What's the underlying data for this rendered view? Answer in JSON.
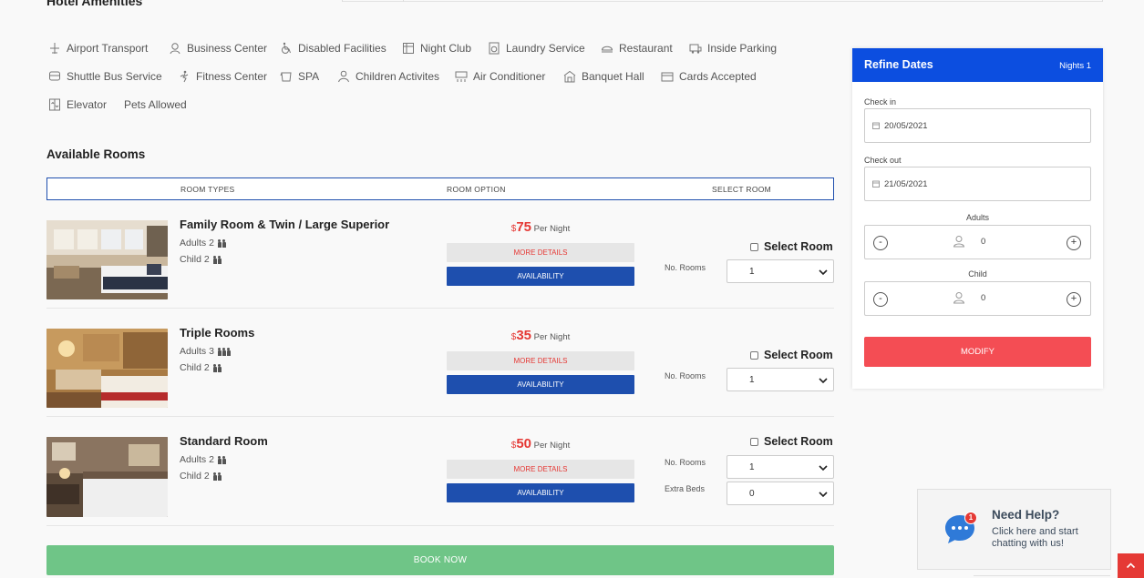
{
  "amenities_title": "Hotel Amenities",
  "amenities": [
    {
      "label": "Airport Transport",
      "icon": "airplane-icon"
    },
    {
      "label": "Business Center",
      "icon": "business-center-icon"
    },
    {
      "label": "Disabled Facilities",
      "icon": "wheelchair-icon"
    },
    {
      "label": "Night Club",
      "icon": "night-club-icon"
    },
    {
      "label": "Laundry Service",
      "icon": "laundry-icon"
    },
    {
      "label": "Restaurant",
      "icon": "restaurant-icon"
    },
    {
      "label": "Inside Parking",
      "icon": "parking-icon"
    },
    {
      "label": "Shuttle Bus Service",
      "icon": "bus-icon"
    },
    {
      "label": "Fitness Center",
      "icon": "fitness-icon"
    },
    {
      "label": "SPA",
      "icon": "spa-icon"
    },
    {
      "label": "Children Activites",
      "icon": "children-icon"
    },
    {
      "label": "Air Conditioner",
      "icon": "air-conditioner-icon"
    },
    {
      "label": "Banquet Hall",
      "icon": "banquet-hall-icon"
    },
    {
      "label": "Cards Accepted",
      "icon": "credit-card-icon"
    },
    {
      "label": "Elevator",
      "icon": "elevator-icon"
    },
    {
      "label": "Pets Allowed",
      "icon": ""
    }
  ],
  "rooms_section": {
    "title": "Available Rooms",
    "headers": [
      "ROOM TYPES",
      "ROOM OPTION",
      "SELECT ROOM"
    ]
  },
  "rooms": [
    {
      "name": "Family Room & Twin / Large Superior",
      "adults_label": "Adults 2",
      "adults": 2,
      "child_label": "Child 2",
      "children": 2,
      "currency": "$",
      "price": "75",
      "per": "Per Night",
      "more_details": "MORE DETAILS",
      "availability": "AVAILABILITY",
      "select_label": "Select Room",
      "rooms_label": "No. Rooms",
      "rooms_value": "1"
    },
    {
      "name": "Triple Rooms",
      "adults_label": "Adults 3",
      "adults": 3,
      "child_label": "Child 2",
      "children": 2,
      "currency": "$",
      "price": "35",
      "per": "Per Night",
      "more_details": "MORE DETAILS",
      "availability": "AVAILABILITY",
      "select_label": "Select Room",
      "rooms_label": "No. Rooms",
      "rooms_value": "1"
    },
    {
      "name": "Standard Room",
      "adults_label": "Adults 2",
      "adults": 2,
      "child_label": "Child 2",
      "children": 2,
      "currency": "$",
      "price": "50",
      "per": "Per Night",
      "more_details": "MORE DETAILS",
      "availability": "AVAILABILITY",
      "select_label": "Select Room",
      "rooms_label": "No. Rooms",
      "rooms_value": "1",
      "beds_label": "Extra Beds",
      "beds_value": "0"
    }
  ],
  "book_now": "BOOK NOW",
  "refine": {
    "title": "Refine Dates",
    "nights": "Nights 1",
    "checkin_label": "Check in",
    "checkin_value": "20/05/2021",
    "checkout_label": "Check out",
    "checkout_value": "21/05/2021",
    "adults_label": "Adults",
    "adults_value": "0",
    "child_label": "Child",
    "child_value": "0",
    "minus": "-",
    "plus": "+",
    "modify": "MODIFY"
  },
  "help": {
    "title": "Need Help?",
    "subtitle": "Click here and start chatting with us!",
    "badge": "1"
  },
  "colors": {
    "primary": "#0c4ee0",
    "availability": "#1e4fae",
    "price": "#e53935",
    "book_now": "#6fc587",
    "modify": "#f44d54"
  }
}
